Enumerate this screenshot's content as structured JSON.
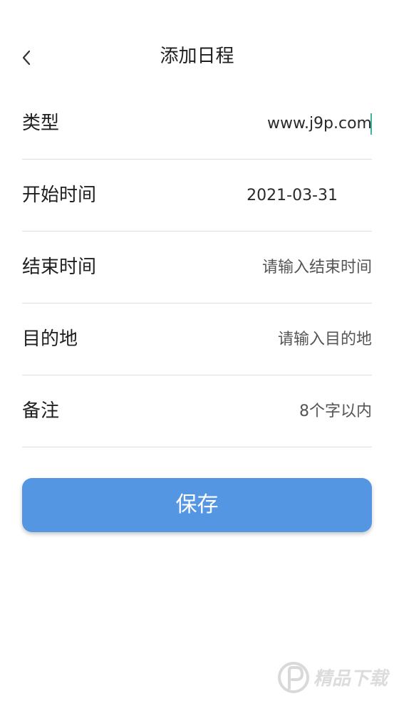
{
  "header": {
    "title": "添加日程",
    "back_icon": "chevron-left-icon"
  },
  "form": {
    "type": {
      "label": "类型",
      "value": "www.j9p.com",
      "placeholder": ""
    },
    "start_time": {
      "label": "开始时间",
      "value": "2021-03-31",
      "placeholder": ""
    },
    "end_time": {
      "label": "结束时间",
      "value": "",
      "placeholder": "请输入结束时间"
    },
    "destination": {
      "label": "目的地",
      "value": "",
      "placeholder": "请输入目的地"
    },
    "note": {
      "label": "备注",
      "value": "",
      "placeholder": "8个字以内"
    }
  },
  "save_button": {
    "label": "保存"
  },
  "watermark": {
    "text": "精品下载"
  },
  "colors": {
    "accent": "#5596e3",
    "caret": "#3fb39f",
    "divider": "#dedede"
  }
}
